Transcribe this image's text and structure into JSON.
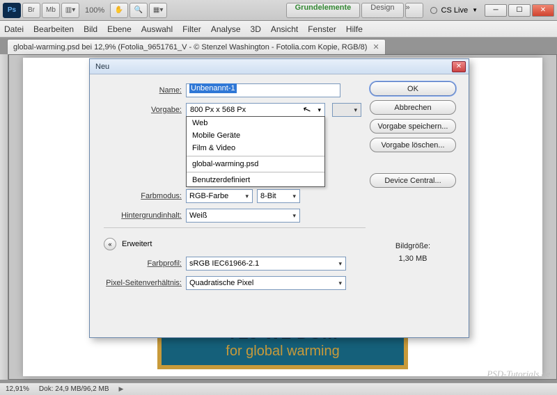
{
  "toolbar": {
    "ps_label": "Ps",
    "br_label": "Br",
    "mb_label": "Mb",
    "zoom": "100%",
    "workspace": {
      "grund": "Grundelemente",
      "design": "Design",
      "more": "»"
    },
    "cslive": "CS Live"
  },
  "menubar": [
    "Datei",
    "Bearbeiten",
    "Bild",
    "Ebene",
    "Auswahl",
    "Filter",
    "Analyse",
    "3D",
    "Ansicht",
    "Fenster",
    "Hilfe"
  ],
  "doctab": {
    "title": "global-warming.psd bei 12,9% (Fotolia_9651761_V - © Stenzel Washington - Fotolia.com Kopie, RGB/8)"
  },
  "banner": {
    "line1": "TLJ WL DUIII",
    "line2": "for global warming"
  },
  "dialog": {
    "title": "Neu",
    "labels": {
      "name": "Name:",
      "vorgabe": "Vorgabe:",
      "farbmodus": "Farbmodus:",
      "hintergrund": "Hintergrundinhalt:",
      "erweitert": "Erweitert",
      "farbprofil": "Farbprofil:",
      "pixelsv": "Pixel-Seitenverhältnis:"
    },
    "name_value": "Unbenannt-1",
    "vorgabe_selected": "800 Px x 568 Px",
    "vorgabe_options": [
      "Web",
      "Mobile Geräte",
      "Film & Video",
      "global-warming.psd",
      "Benutzerdefiniert"
    ],
    "farbmodus_value": "RGB-Farbe",
    "bit_value": "8-Bit",
    "hintergrund_value": "Weiß",
    "farbprofil_value": "sRGB IEC61966-2.1",
    "pixelsv_value": "Quadratische Pixel",
    "buttons": {
      "ok": "OK",
      "abbrechen": "Abbrechen",
      "speichern": "Vorgabe speichern...",
      "loeschen": "Vorgabe löschen...",
      "devicecentral": "Device Central..."
    },
    "bildgroesse_label": "Bildgröße:",
    "bildgroesse_value": "1,30 MB"
  },
  "statusbar": {
    "zoom": "12,91%",
    "dok": "Dok: 24,9 MB/96,2 MB"
  },
  "watermark": "PSD-Tutorials.de"
}
